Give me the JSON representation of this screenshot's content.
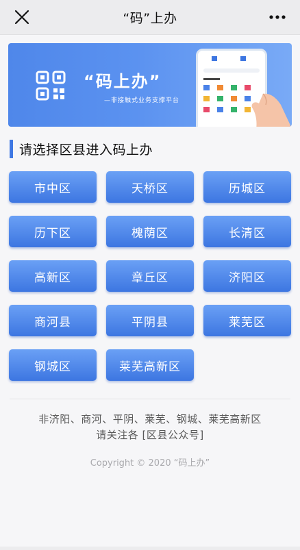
{
  "nav": {
    "title": "“码”上办",
    "close_icon": "close-icon",
    "more_icon": "more-icon"
  },
  "banner": {
    "title": "“码上办”",
    "slogan": "—非接触式业务支撑平台",
    "brand_color": "#4f87ea"
  },
  "section": {
    "title": "请选择区县进入码上办",
    "accent": "#3f78e3"
  },
  "districts": [
    "市中区",
    "天桥区",
    "历城区",
    "历下区",
    "槐荫区",
    "长清区",
    "高新区",
    "章丘区",
    "济阳区",
    "商河县",
    "平阴县",
    "莱芜区",
    "钢城区",
    "莱芜高新区"
  ],
  "notice": {
    "line1": "非济阳、商河、平阴、莱芜、钢城、莱芜高新区",
    "line2": "请关注各 [区县公众号]"
  },
  "copyright": "Copyright © 2020 “码上办”",
  "button_color": "#4a82e8"
}
